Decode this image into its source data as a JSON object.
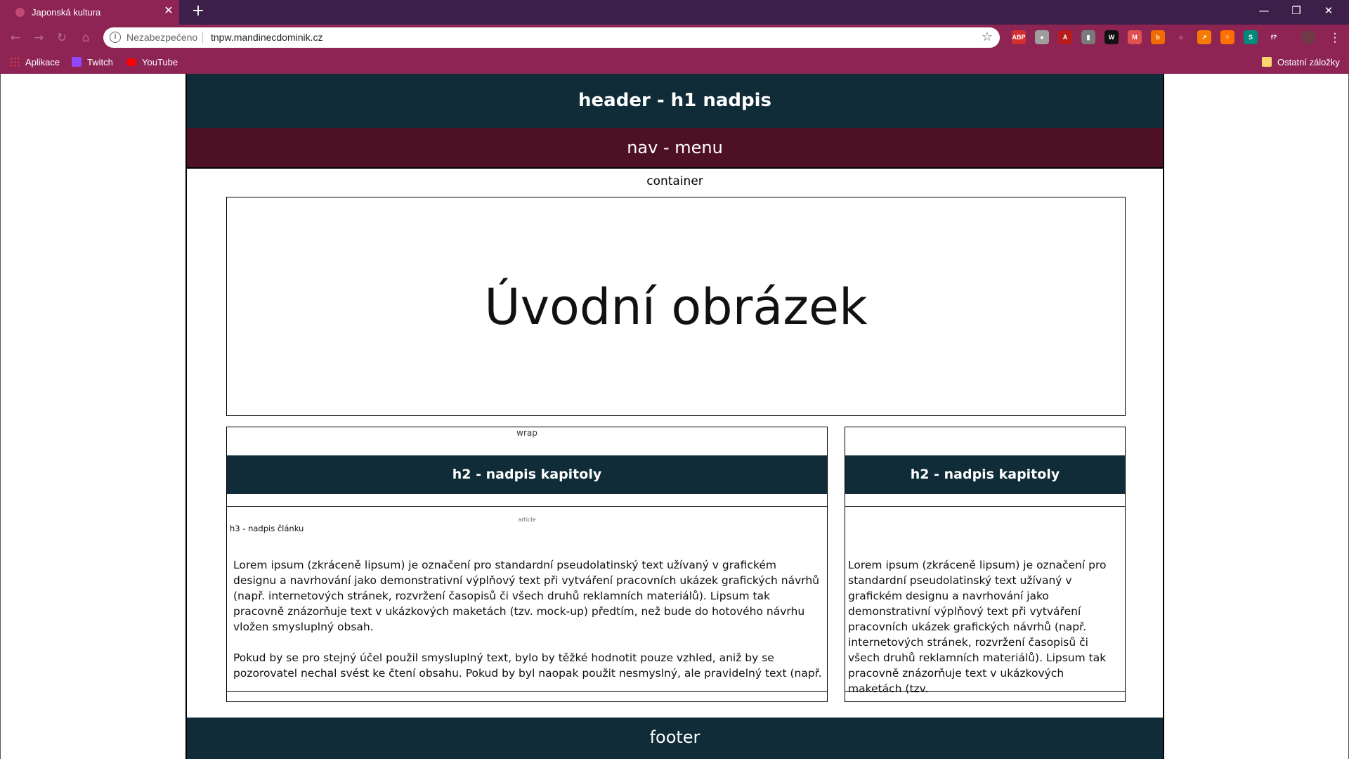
{
  "browser": {
    "tab_title": "Japonská kultura",
    "tab_close": "✕",
    "new_tab": "+",
    "window_buttons": {
      "minimize": "—",
      "restore": "❐",
      "close": "✕"
    },
    "nav": {
      "back": "←",
      "forward": "→",
      "reload": "↻",
      "home": "⌂"
    },
    "address": {
      "info": "i",
      "security": "Nezabezpečeno",
      "url": "tnpw.mandinecdominik.cz",
      "star": "☆"
    },
    "extensions": [
      {
        "name": "adblock-plus-icon",
        "label": "ABP",
        "color": "#d32f2f"
      },
      {
        "name": "ghost-extension-icon",
        "label": "●",
        "color": "#9e9e9e"
      },
      {
        "name": "pdf-extension-icon",
        "label": "A",
        "color": "#b71c1c"
      },
      {
        "name": "clipboard-extension-icon",
        "label": "▮",
        "color": "#7a7a7a"
      },
      {
        "name": "w-extension-icon",
        "label": "W",
        "color": "#111111"
      },
      {
        "name": "gmail-extension-icon",
        "label": "M",
        "color": "#e05050"
      },
      {
        "name": "b-extension-icon",
        "label": "b",
        "color": "#ef6c00"
      },
      {
        "name": "circle-extension-icon",
        "label": "○",
        "color": "#8e2454"
      },
      {
        "name": "arrow-extension-icon",
        "label": "↗",
        "color": "#f57c00"
      },
      {
        "name": "dots-extension-icon",
        "label": "⁘",
        "color": "#ff6f00"
      },
      {
        "name": "s-extension-icon",
        "label": "S",
        "color": "#00897b"
      },
      {
        "name": "formula-extension-icon",
        "label": "f?",
        "color": "#8e2454"
      }
    ],
    "menu_dots": "⋮",
    "bookmarks": [
      {
        "label": "Aplikace",
        "icon": "apps-grid-icon",
        "color": "#f4b400"
      },
      {
        "label": "Twitch",
        "icon": "twitch-icon",
        "color": "#9146ff"
      },
      {
        "label": "YouTube",
        "icon": "youtube-icon",
        "color": "#ff0000"
      }
    ],
    "other_bookmarks": "Ostatní záložky"
  },
  "page": {
    "header": "header - h1 nadpis",
    "nav": "nav - menu",
    "container_label": "container",
    "hero": "Úvodní obrázek",
    "left": {
      "wrap_label": "wrap",
      "chapter": "h2 - nadpis kapitoly",
      "article_label": "article",
      "h3": "h3 - nadpis článku",
      "p1": "Lorem ipsum (zkráceně lipsum) je označení pro standardní pseudolatinský text užívaný v grafickém designu a navrhování jako demonstrativní výplňový text při vytváření pracovních ukázek grafických návrhů (např. internetových stránek, rozvržení časopisů či všech druhů reklamních materiálů). Lipsum tak pracovně znázorňuje text v ukázkových maketách (tzv. mock-up) předtím, než bude do hotového návrhu vložen smysluplný obsah.",
      "p2": "Pokud by se pro stejný účel použil smysluplný text, bylo by těžké hodnotit pouze vzhled, aniž by se pozorovatel nechal svést ke čtení obsahu. Pokud by byl naopak použit nesmyslný, ale pravidelný text (např."
    },
    "right": {
      "chapter": "h2 - nadpis kapitoly",
      "p1": "Lorem ipsum (zkráceně lipsum) je označení pro standardní pseudolatinský text užívaný v grafickém designu a navrhování jako demonstrativní výplňový text při vytváření pracovních ukázek grafických návrhů (např. internetových stránek, rozvržení časopisů či všech druhů reklamních materiálů). Lipsum tak pracovně znázorňuje text v ukázkových maketách (tzv."
    },
    "footer": "footer",
    "colors": {
      "dark_teal": "#0f2c38",
      "maroon": "#4e1024",
      "chrome": "#8e2454",
      "tabbar": "#3d1f49"
    }
  }
}
